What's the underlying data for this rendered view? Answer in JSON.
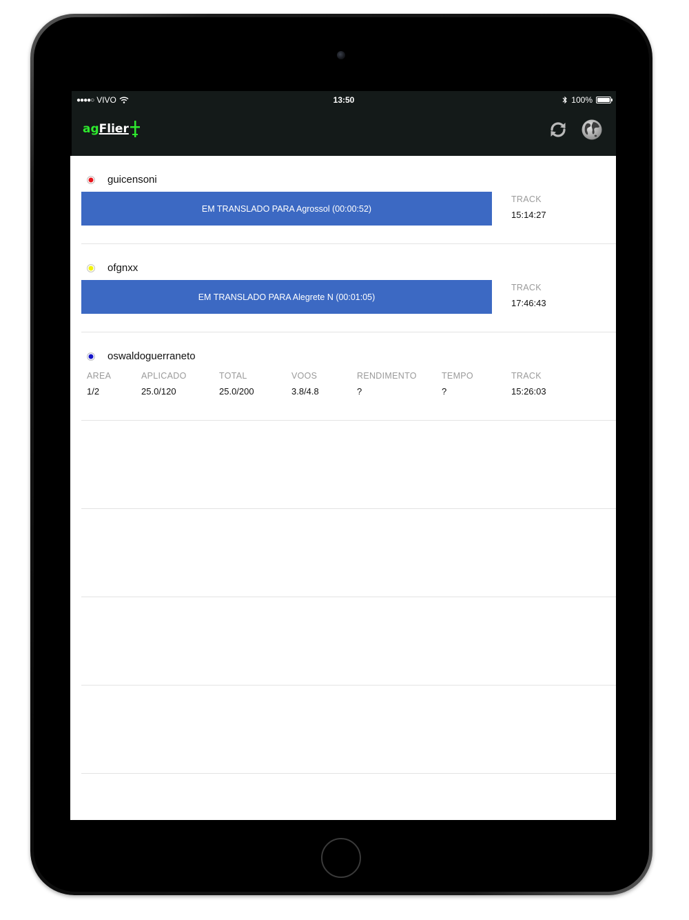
{
  "status_bar": {
    "carrier": "VIVO",
    "signal": "●●●●○",
    "time": "13:50",
    "battery": "100%",
    "battery_level": 1.0
  },
  "app": {
    "logo_ag": "ag",
    "logo_flier": "Flier",
    "brand_green": "#2ee82e",
    "accent_blue": "#3c69c3",
    "toolbar_icons": [
      "refresh-icon",
      "globe-icon"
    ]
  },
  "rows": [
    {
      "name": "guicensoni",
      "dot_color": "#e8141a",
      "status": "EM TRANSLADO PARA Agrossol (00:00:52)",
      "track_label": "TRACK",
      "track_value": "15:14:27"
    },
    {
      "name": "ofgnxx",
      "dot_color": "#f2f20c",
      "status": "EM TRANSLADO PARA Alegrete N (00:01:05)",
      "track_label": "TRACK",
      "track_value": "17:46:43"
    },
    {
      "name": "oswaldoguerraneto",
      "dot_color": "#1414c8",
      "stats": [
        {
          "label": "AREA",
          "value": "1/2"
        },
        {
          "label": "APLICADO",
          "value": "25.0/120"
        },
        {
          "label": "TOTAL",
          "value": "25.0/200"
        },
        {
          "label": "VOOS",
          "value": "3.8/4.8"
        },
        {
          "label": "RENDIMENTO",
          "value": "?"
        },
        {
          "label": "TEMPO",
          "value": "?"
        },
        {
          "label": "TRACK",
          "value": "15:26:03"
        }
      ]
    }
  ]
}
